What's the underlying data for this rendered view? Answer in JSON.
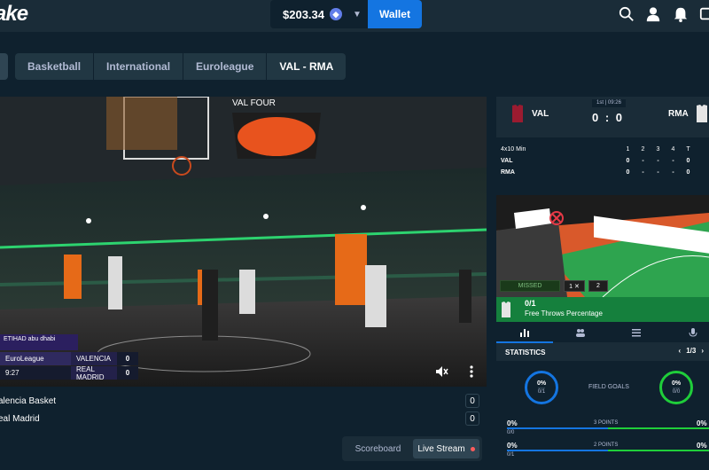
{
  "header": {
    "logo": "ake",
    "balance": "$203.34",
    "currency_icon": "ethereum-icon",
    "wallet_label": "Wallet"
  },
  "breadcrumbs": [
    "Basketball",
    "International",
    "Euroleague",
    "VAL - RMA"
  ],
  "video": {
    "tv_brand": "ETIHAD abu dhabi",
    "tv_league": "EuroLeague",
    "tv_home": "VALENCIA",
    "tv_away": "REAL MADRID",
    "tv_home_score": "0",
    "tv_away_score": "0",
    "tv_clock": "9:27",
    "tv_arena_sign": "VAL FOUR"
  },
  "teams": [
    {
      "name": "alencia Basket",
      "score": "0"
    },
    {
      "name": "eal Madrid",
      "score": "0"
    }
  ],
  "toggle": {
    "scoreboard": "Scoreboard",
    "live": "Live Stream"
  },
  "scoreboard": {
    "home": "VAL",
    "away": "RMA",
    "period": "1st | 09:26",
    "score": "0 : 0",
    "format": "4x10 Min",
    "quarters": [
      "1",
      "2",
      "3",
      "4",
      "T"
    ],
    "rows": [
      {
        "team": "VAL",
        "q": [
          "0",
          "-",
          "-",
          "-",
          "0"
        ]
      },
      {
        "team": "RMA",
        "q": [
          "0",
          "-",
          "-",
          "-",
          "0"
        ]
      }
    ],
    "home_color": "#9b1b30",
    "away_color": "#e5e5e5"
  },
  "court": {
    "missed": "MISSED",
    "x_count": "1 ✕",
    "n_count": "2",
    "ft_value": "0/1",
    "ft_label": "Free Throws Percentage"
  },
  "tabs": [
    "stats-icon",
    "players-icon",
    "lineup-icon",
    "commentary-icon"
  ],
  "statistics": {
    "title": "STATISTICS",
    "page": "1/3",
    "fg_label": "FIELD GOALS",
    "home_fg_pct": "0%",
    "home_fg": "0/1",
    "away_fg_pct": "0%",
    "away_fg": "0/0",
    "rows": [
      {
        "label": "3 POINTS",
        "home_pct": "0%",
        "home": "0/0",
        "away_pct": "0%"
      },
      {
        "label": "2 POINTS",
        "home_pct": "0%",
        "home": "0/1",
        "away_pct": "0%"
      }
    ]
  }
}
